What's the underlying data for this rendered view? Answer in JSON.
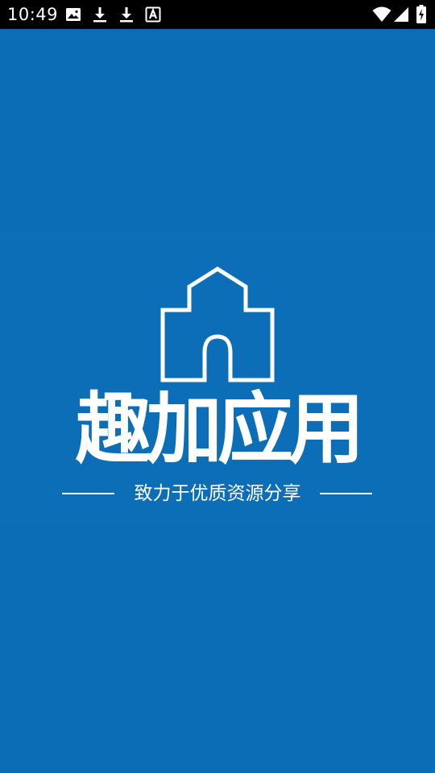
{
  "status_bar": {
    "time": "10:49",
    "left_icons": [
      "image-icon",
      "download-icon",
      "download-icon",
      "font-a-icon"
    ],
    "right_icons": [
      "wifi-icon",
      "cell-signal-icon",
      "battery-charging-icon"
    ]
  },
  "splash": {
    "app_name": "趣加应用",
    "tagline": "致力于优质资源分享",
    "logo_icon": "house-outline-icon",
    "background_color": "#0a6db5",
    "foreground_color": "#ffffff"
  }
}
